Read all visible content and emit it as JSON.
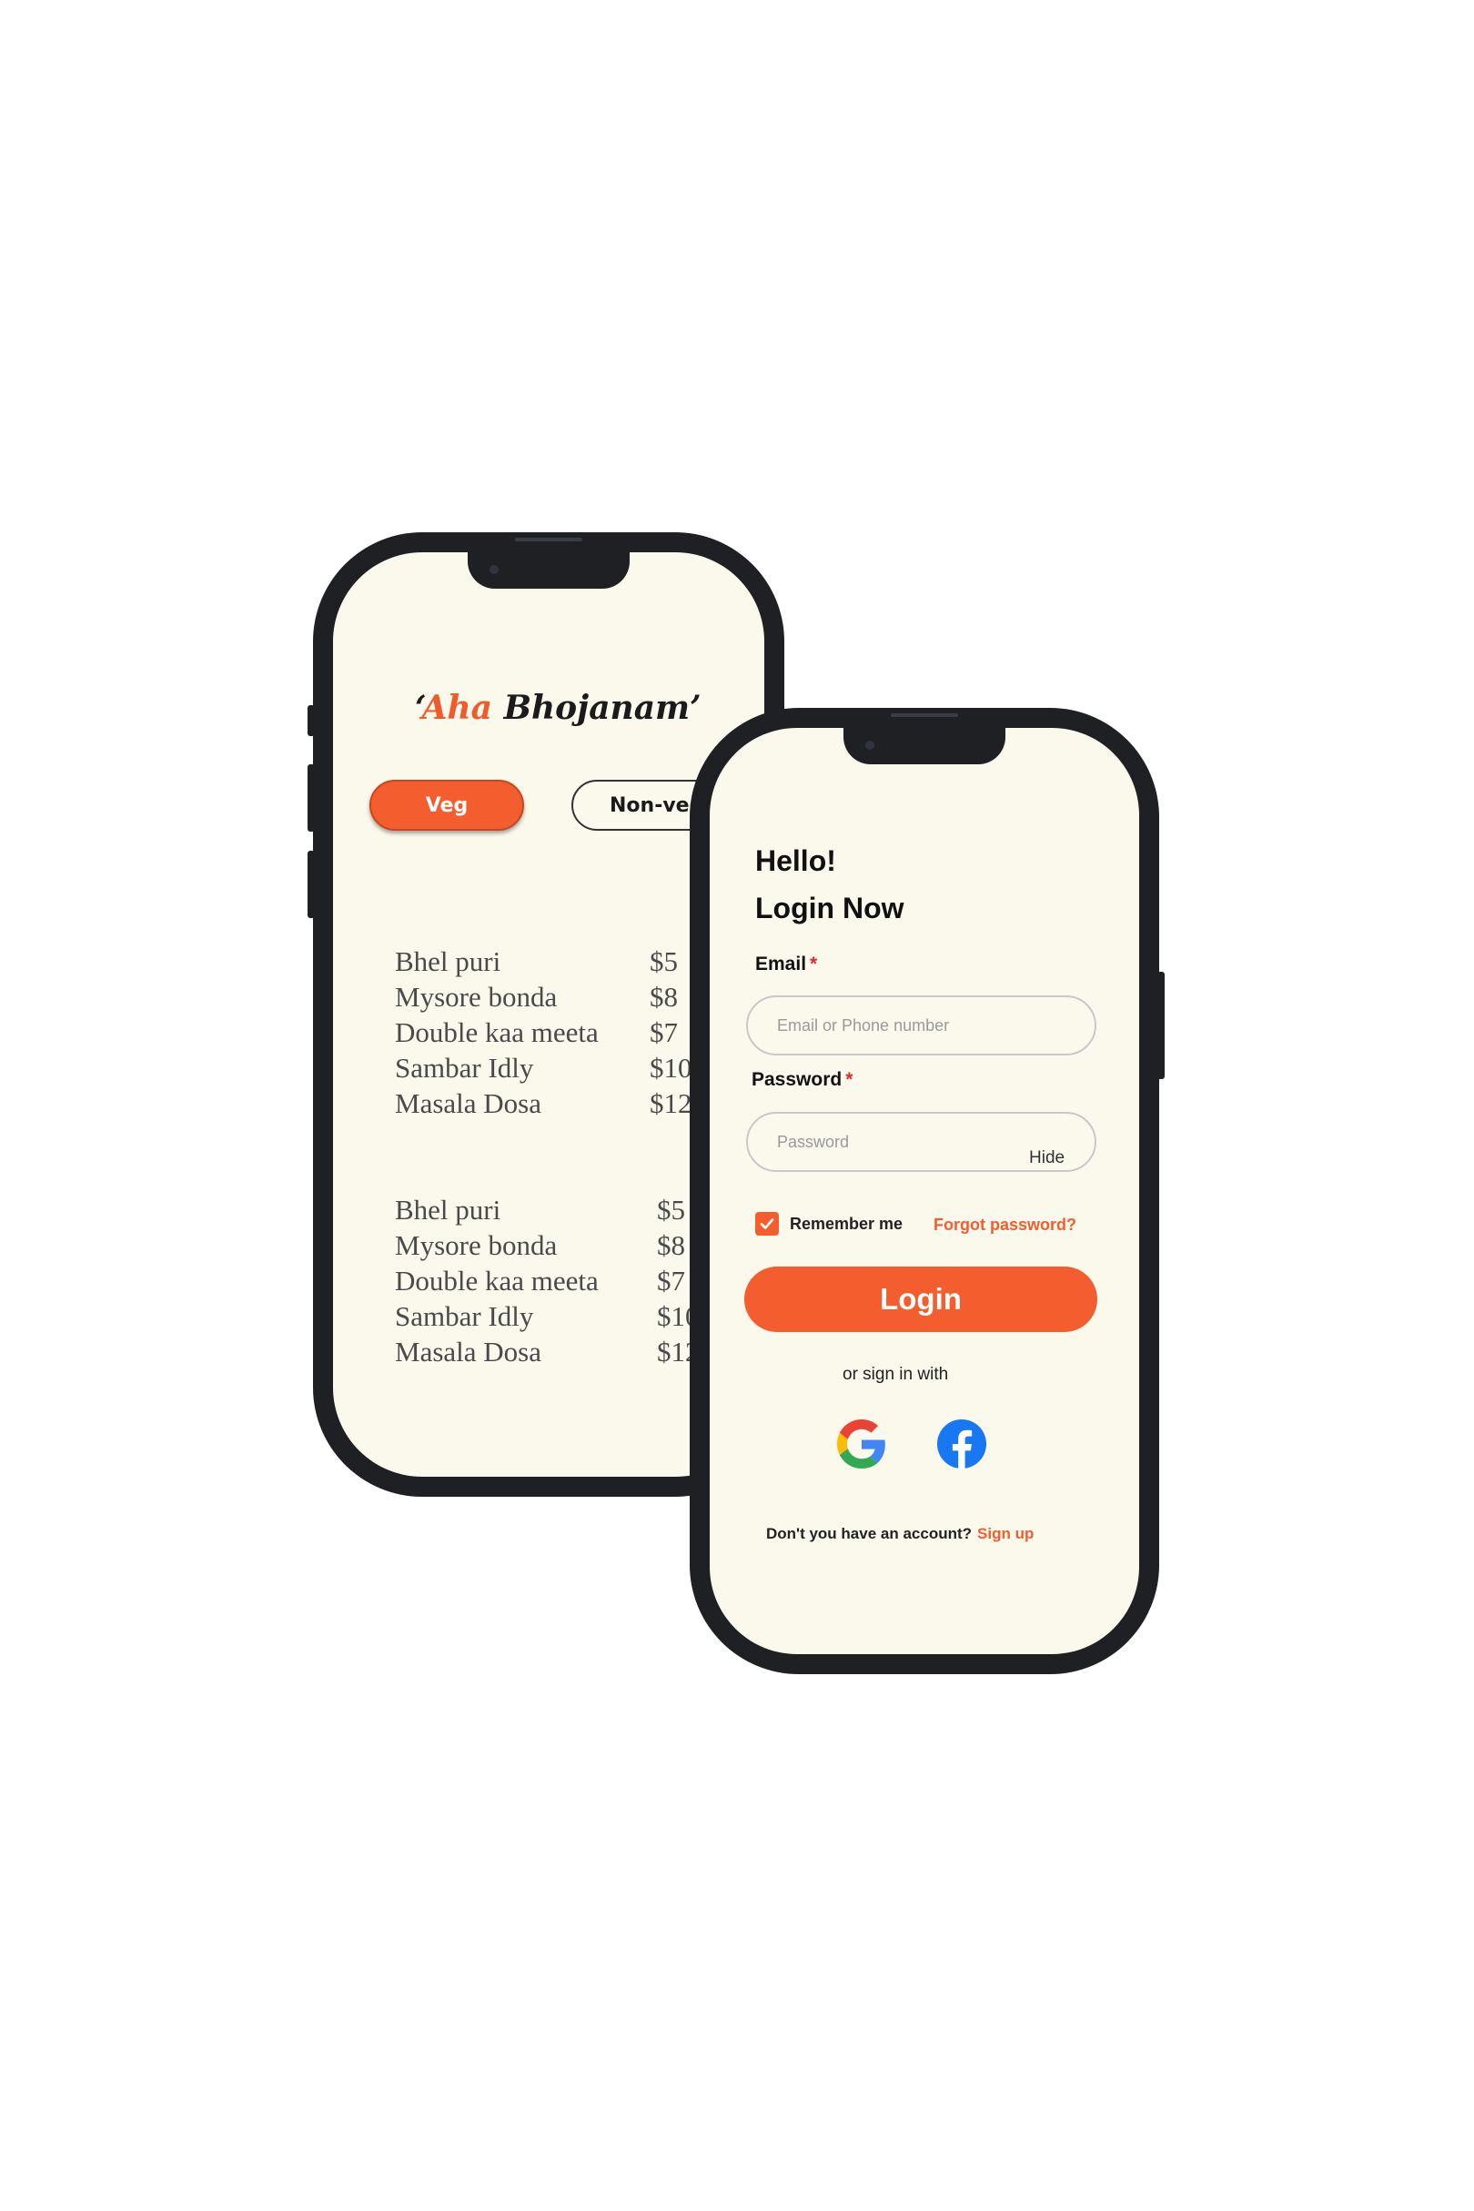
{
  "menu_app": {
    "brand_quote_open": "‘",
    "brand_accent": "Aha",
    "brand_rest": "Bhojanam’",
    "tabs": [
      {
        "label": "Veg"
      },
      {
        "label": "Non-veg"
      }
    ],
    "section1": {
      "items": [
        "Bhel puri",
        "Mysore bonda",
        "Double kaa meeta",
        "Sambar Idly",
        "Masala Dosa"
      ],
      "prices": [
        "$5",
        "$8",
        "$7",
        "$10",
        "$12"
      ]
    },
    "section2": {
      "items": [
        "Bhel puri",
        "Mysore bonda",
        "Double kaa meeta",
        "Sambar Idly",
        "Masala Dosa"
      ],
      "prices": [
        "$5",
        "$8",
        "$7",
        "$10",
        "$12"
      ]
    }
  },
  "login_app": {
    "greeting": "Hello!",
    "title": "Login Now",
    "email_label": "Email",
    "required_mark": "*",
    "email_placeholder": "Email or Phone number",
    "password_label": "Password",
    "password_placeholder": "Password",
    "hide_label": "Hide",
    "remember_label": "Remember me",
    "remember_checked": true,
    "forgot_label": "Forgot password?",
    "login_button": "Login",
    "or_text": "or  sign in with",
    "social_icons": [
      "google-icon",
      "facebook-icon"
    ],
    "no_account_text": "Don't you have an account?",
    "signup_link": "Sign up"
  },
  "colors": {
    "accent": "#f45d2d",
    "screen_bg": "#fbf9ec",
    "frame": "#1e2024",
    "facebook": "#1877f2"
  }
}
